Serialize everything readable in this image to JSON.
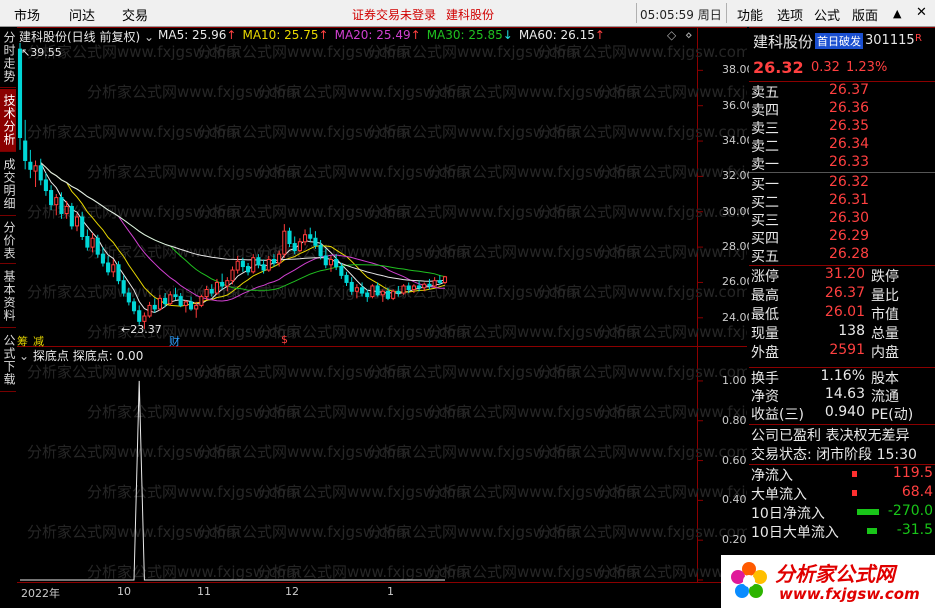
{
  "menu": {
    "items": [
      "市场",
      "问达",
      "交易"
    ],
    "notice": "证券交易未登录",
    "stock_link": "建科股份",
    "clock": "05:05:59",
    "weekday": "周日",
    "right_items": [
      "功能",
      "选项",
      "公式",
      "版面"
    ],
    "collapse_glyph": "▲",
    "close_glyph": "✕"
  },
  "left_tabs": [
    {
      "label": "分时走势",
      "active": false
    },
    {
      "label": "技术分析",
      "active": true
    },
    {
      "label": "成交明细",
      "active": false
    },
    {
      "label": "分价表",
      "active": false
    },
    {
      "label": "基本资料",
      "active": false
    },
    {
      "label": "公式下载",
      "active": false
    }
  ],
  "chart_header": {
    "title": "建科股份(日线 前复权)",
    "ma": [
      {
        "label": "MA5:",
        "value": "25.96",
        "color": "#e8e8e8",
        "arrow": "↑",
        "arrow_color": "#ff4040"
      },
      {
        "label": "MA10:",
        "value": "25.75",
        "color": "#e8d800",
        "arrow": "↑",
        "arrow_color": "#ff4040"
      },
      {
        "label": "MA20:",
        "value": "25.49",
        "color": "#d040d0",
        "arrow": "↑",
        "arrow_color": "#ff4040"
      },
      {
        "label": "MA30:",
        "value": "25.85",
        "color": "#20c020",
        "arrow": "↓",
        "arrow_color": "#20e0e0"
      },
      {
        "label": "MA60:",
        "value": "26.15",
        "color": "#e8e8e8",
        "arrow": "↑",
        "arrow_color": "#ff4040"
      }
    ]
  },
  "indicator_header": {
    "name": "探底点",
    "label": "探底点:",
    "value": "0.00"
  },
  "annotations": {
    "high": "39.55",
    "low": "23.37",
    "events": [
      "财",
      "$",
      "减",
      "筹"
    ]
  },
  "watermark": "分析家公式网www.fxjgsw.com",
  "chart_data": [
    {
      "type": "candlestick",
      "title": "建科股份(日线 前复权)",
      "y_ticks": [
        24.0,
        26.0,
        28.0,
        30.0,
        32.0,
        34.0,
        36.0,
        38.0
      ],
      "ylim": [
        22.8,
        40.0
      ],
      "x_labels": [
        "2022年",
        "10",
        "11",
        "12",
        "1"
      ],
      "grid": false,
      "ohlc": [
        [
          39.2,
          39.55,
          33.5,
          34.2
        ],
        [
          34.0,
          35.2,
          32.4,
          32.9
        ],
        [
          32.8,
          33.5,
          31.9,
          32.4
        ],
        [
          32.3,
          32.9,
          31.4,
          32.6
        ],
        [
          32.6,
          33.0,
          31.5,
          31.8
        ],
        [
          31.8,
          32.2,
          30.9,
          31.2
        ],
        [
          31.2,
          31.5,
          30.1,
          30.4
        ],
        [
          30.4,
          31.0,
          29.8,
          30.8
        ],
        [
          30.8,
          31.1,
          29.6,
          29.9
        ],
        [
          29.9,
          30.6,
          29.6,
          30.3
        ],
        [
          30.3,
          30.5,
          29.0,
          29.2
        ],
        [
          29.2,
          29.9,
          28.9,
          29.7
        ],
        [
          29.7,
          30.0,
          28.4,
          28.6
        ],
        [
          28.6,
          29.0,
          27.8,
          28.0
        ],
        [
          28.0,
          28.8,
          27.7,
          28.5
        ],
        [
          28.5,
          28.7,
          27.4,
          27.6
        ],
        [
          27.6,
          28.0,
          26.9,
          27.1
        ],
        [
          27.1,
          27.5,
          26.4,
          26.6
        ],
        [
          26.6,
          27.3,
          26.3,
          27.0
        ],
        [
          27.0,
          27.2,
          25.9,
          26.1
        ],
        [
          26.1,
          26.4,
          25.2,
          25.4
        ],
        [
          25.4,
          25.7,
          24.7,
          24.9
        ],
        [
          24.9,
          25.1,
          24.2,
          24.4
        ],
        [
          24.4,
          24.7,
          23.6,
          23.8
        ],
        [
          23.8,
          24.3,
          23.37,
          24.1
        ],
        [
          24.1,
          24.9,
          24.0,
          24.7
        ],
        [
          24.7,
          25.1,
          24.3,
          24.5
        ],
        [
          24.5,
          25.3,
          24.4,
          25.1
        ],
        [
          25.1,
          25.4,
          24.6,
          24.8
        ],
        [
          24.8,
          25.5,
          24.7,
          25.3
        ],
        [
          25.3,
          25.7,
          25.0,
          25.2
        ],
        [
          25.2,
          25.4,
          24.6,
          24.7
        ],
        [
          24.7,
          25.0,
          24.3,
          24.9
        ],
        [
          24.9,
          25.2,
          24.4,
          24.5
        ],
        [
          24.5,
          24.9,
          24.0,
          24.7
        ],
        [
          24.7,
          25.3,
          24.6,
          25.2
        ],
        [
          25.2,
          25.8,
          25.0,
          25.6
        ],
        [
          25.6,
          25.9,
          25.2,
          25.4
        ],
        [
          25.4,
          26.2,
          25.3,
          26.0
        ],
        [
          26.0,
          26.5,
          25.6,
          25.8
        ],
        [
          25.8,
          26.3,
          25.5,
          26.1
        ],
        [
          26.1,
          26.9,
          25.9,
          26.7
        ],
        [
          26.7,
          27.5,
          26.5,
          27.2
        ],
        [
          27.2,
          27.4,
          26.6,
          26.9
        ],
        [
          26.9,
          27.1,
          26.4,
          26.6
        ],
        [
          26.6,
          27.6,
          26.5,
          27.4
        ],
        [
          27.4,
          27.6,
          26.8,
          27.0
        ],
        [
          27.0,
          27.3,
          26.5,
          26.7
        ],
        [
          26.7,
          27.5,
          26.6,
          27.3
        ],
        [
          27.3,
          27.6,
          26.9,
          27.1
        ],
        [
          27.1,
          27.8,
          26.9,
          27.6
        ],
        [
          27.6,
          29.3,
          27.4,
          28.9
        ],
        [
          28.9,
          29.1,
          28.0,
          28.2
        ],
        [
          28.2,
          28.6,
          27.6,
          27.8
        ],
        [
          27.8,
          28.5,
          27.7,
          28.3
        ],
        [
          28.3,
          29.0,
          28.1,
          28.7
        ],
        [
          28.7,
          29.1,
          28.3,
          28.5
        ],
        [
          28.5,
          28.9,
          27.9,
          28.1
        ],
        [
          28.1,
          28.4,
          27.3,
          27.5
        ],
        [
          27.5,
          27.9,
          26.8,
          27.0
        ],
        [
          27.0,
          27.5,
          26.6,
          27.3
        ],
        [
          27.3,
          27.6,
          26.7,
          26.9
        ],
        [
          26.9,
          27.1,
          26.2,
          26.4
        ],
        [
          26.4,
          26.6,
          25.8,
          26.0
        ],
        [
          26.0,
          26.3,
          25.3,
          25.5
        ],
        [
          25.5,
          25.9,
          25.1,
          25.7
        ],
        [
          25.7,
          26.0,
          25.2,
          25.4
        ],
        [
          25.4,
          25.6,
          24.9,
          25.2
        ],
        [
          25.2,
          25.9,
          25.1,
          25.8
        ],
        [
          25.8,
          26.0,
          25.2,
          25.3
        ],
        [
          25.3,
          25.6,
          24.9,
          25.5
        ],
        [
          25.5,
          25.7,
          25.0,
          25.1
        ],
        [
          25.1,
          25.6,
          25.0,
          25.5
        ],
        [
          25.5,
          25.8,
          25.2,
          25.4
        ],
        [
          25.4,
          25.9,
          25.3,
          25.8
        ],
        [
          25.8,
          26.0,
          25.4,
          25.6
        ],
        [
          25.6,
          25.9,
          25.4,
          25.8
        ],
        [
          25.8,
          26.1,
          25.5,
          25.7
        ],
        [
          25.7,
          26.0,
          25.5,
          25.9
        ],
        [
          25.9,
          26.2,
          25.6,
          25.8
        ],
        [
          25.8,
          26.3,
          25.7,
          26.1
        ],
        [
          26.1,
          26.4,
          25.9,
          26.0
        ],
        [
          26.0,
          26.37,
          25.9,
          26.32
        ]
      ],
      "series": [
        {
          "name": "MA5",
          "color": "#e8e8e8",
          "period": 5
        },
        {
          "name": "MA10",
          "color": "#e8d800",
          "period": 10
        },
        {
          "name": "MA20",
          "color": "#d040d0",
          "period": 20
        },
        {
          "name": "MA30",
          "color": "#20c020",
          "period": 30
        },
        {
          "name": "MA60",
          "color": "#e8e8e8",
          "period": 60
        }
      ]
    },
    {
      "type": "line",
      "title": "探底点",
      "y_ticks": [
        0.0,
        0.2,
        0.4,
        0.6,
        0.8,
        1.0
      ],
      "ylim": [
        0,
        1.08
      ],
      "values": [
        0,
        0,
        0,
        0,
        0,
        0,
        0,
        0,
        0,
        0,
        0,
        0,
        0,
        0,
        0,
        0,
        0,
        0,
        0,
        0,
        0,
        0,
        0,
        1,
        0,
        0,
        0,
        0,
        0,
        0,
        0,
        0,
        0,
        0,
        0,
        0,
        0,
        0,
        0,
        0,
        0,
        0,
        0,
        0,
        0,
        0,
        0,
        0,
        0,
        0,
        0,
        0,
        0,
        0,
        0,
        0,
        0,
        0,
        0,
        0,
        0,
        0,
        0,
        0,
        0,
        0,
        0,
        0,
        0,
        0,
        0,
        0,
        0,
        0,
        0,
        0,
        0,
        0,
        0,
        0,
        0,
        0,
        0
      ]
    }
  ],
  "quote": {
    "name": "建科股份",
    "tag": "首日破发",
    "code": "301115",
    "r_mark": "R",
    "price": "26.32",
    "change": "0.32",
    "change_pct": "1.23%",
    "sells": [
      {
        "label": "卖五",
        "price": "26.37"
      },
      {
        "label": "卖四",
        "price": "26.36"
      },
      {
        "label": "卖三",
        "price": "26.35"
      },
      {
        "label": "卖二",
        "price": "26.34"
      },
      {
        "label": "卖一",
        "price": "26.33"
      }
    ],
    "buys": [
      {
        "label": "买一",
        "price": "26.32"
      },
      {
        "label": "买二",
        "price": "26.31"
      },
      {
        "label": "买三",
        "price": "26.30"
      },
      {
        "label": "买四",
        "price": "26.29"
      },
      {
        "label": "买五",
        "price": "26.28"
      }
    ],
    "stats": [
      {
        "label": "涨停",
        "value": "31.20",
        "right": "跌停",
        "color": "#ff4040"
      },
      {
        "label": "最高",
        "value": "26.37",
        "right": "量比",
        "color": "#ff4040"
      },
      {
        "label": "最低",
        "value": "26.01",
        "right": "市值",
        "color": "#ff4040"
      },
      {
        "label": "现量",
        "value": "138",
        "right": "总量",
        "color": "#e8e8e8"
      },
      {
        "label": "外盘",
        "value": "2591",
        "right": "内盘",
        "color": "#ff4040"
      }
    ],
    "stats2": [
      {
        "label": "换手",
        "value": "1.16%",
        "right": "股本"
      },
      {
        "label": "净资",
        "value": "14.63",
        "right": "流通"
      },
      {
        "label": "收益(三)",
        "value": "0.940",
        "right": "PE(动)"
      }
    ],
    "company_line": "公司已盈利 表决权无差异",
    "trade_status_label": "交易状态:",
    "trade_status": "闭市阶段 15:30",
    "flows": [
      {
        "label": "净流入",
        "value": "119.5",
        "dir": "pos"
      },
      {
        "label": "大单流入",
        "value": "68.4",
        "dir": "pos"
      },
      {
        "label": "10日净流入",
        "value": "-270.0",
        "dir": "neg"
      },
      {
        "label": "10日大单流入",
        "value": "-31.5",
        "dir": "neg"
      }
    ]
  },
  "logo": {
    "text": "分析家公式网",
    "url": "www.fxjgsw.com"
  }
}
